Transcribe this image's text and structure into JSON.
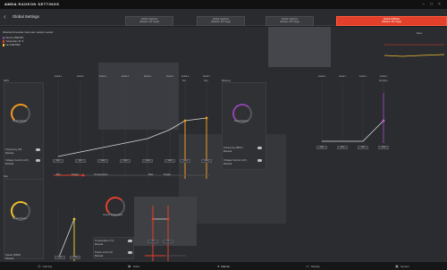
{
  "app": {
    "brand_amd": "AMDA",
    "brand_name": "RADEON SETTINGS"
  },
  "window": {
    "minimize": "–",
    "maximize": "□",
    "close": "×"
  },
  "header": {
    "back_glyph": "‹",
    "title": "Global Settings",
    "profiles": [
      {
        "line1": "Global Graphics",
        "line2": "(Radeon RX Vega)"
      },
      {
        "line1": "Global Graphics",
        "line2": "(Radeon RX Vega)"
      },
      {
        "line1": "Global Graphics",
        "line2": "(Radeon RX Vega)"
      },
      {
        "line1": "Global WattMan",
        "line2": "(Radeon RX Vega)"
      }
    ]
  },
  "legend": {
    "subtitle": "Show last 10 seconds / Auto reset / sample 1 second",
    "items": [
      {
        "label": "Memory 1690 MHz",
        "color": "#8e44ad"
      },
      {
        "label": "Temperature 32 °C",
        "color": "#e2402a"
      },
      {
        "label": "Fan 1680 RPM",
        "color": "#f0c030"
      }
    ],
    "right_label": "Interv."
  },
  "gpu": {
    "section": "GPU",
    "states": [
      "STATE 0",
      "STATE 1",
      "STATE 2",
      "STATE 3",
      "STATE 4",
      "STATE 5",
      "STATE 6",
      "STATE 7"
    ],
    "state_sub": [
      "",
      "",
      "",
      "",
      "",
      "",
      "Min",
      "Max"
    ],
    "gauge_label": "Current Speed",
    "freq_label": "Frequency (%)",
    "freq_sub": "Manual",
    "voltage_label": "Voltage Control (mV)",
    "voltage_sub": "Manual",
    "values": [
      "852",
      "991",
      "1084",
      "1138",
      "1200",
      "1401",
      "1536",
      "1630"
    ]
  },
  "memory": {
    "section": "Memory",
    "states": [
      "STATE 0",
      "STATE 1",
      "STATE 2",
      "STATE 3"
    ],
    "state_sub": [
      "",
      "",
      "",
      "Min/Max"
    ],
    "gauge_label": "Current Speed",
    "freq_label": "Frequency (MHz)",
    "freq_sub": "Manual",
    "voltage_label": "Voltage Control (mV)",
    "voltage_sub": "Manual",
    "values": [
      "800",
      "800",
      "900",
      "1000"
    ]
  },
  "fan": {
    "section": "Fan",
    "gauge_label": "Current Speed",
    "speed_label": "Speed (RPM)",
    "speed_sub": "Manual",
    "min_label": "Min",
    "target_label": "Target",
    "values": [
      "400",
      "2500"
    ]
  },
  "temperature": {
    "section": "Temperature",
    "gauge_label": "Current Temperature",
    "temp_label": "Temperature (°C)",
    "temp_sub": "Manual",
    "powerlimit_label": "Power Limit (%)",
    "powerlimit_sub": "Manual",
    "max_label": "Max",
    "target_label": "Target",
    "values": [
      "75",
      "75"
    ]
  },
  "nav": [
    {
      "label": "Gaming",
      "icon": "gamepad-icon"
    },
    {
      "label": "Video",
      "icon": "video-icon"
    },
    {
      "label": "ReLive",
      "icon": "relive-icon"
    },
    {
      "label": "Display",
      "icon": "display-icon"
    },
    {
      "label": "System",
      "icon": "system-icon"
    }
  ],
  "colors": {
    "accent": "#e2402a",
    "orange": "#f39a1e",
    "yellow": "#f0c030",
    "purple": "#8e44ad"
  }
}
